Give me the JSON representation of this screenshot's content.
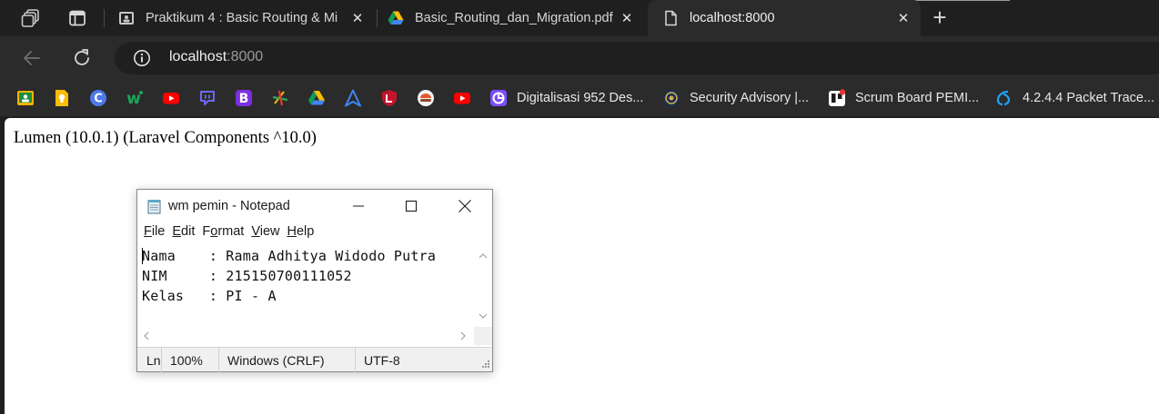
{
  "browser": {
    "tabs": [
      {
        "title": "Praktikum 4 : Basic Routing & Mi",
        "icon": "classroom-page-icon"
      },
      {
        "title": "Basic_Routing_dan_Migration.pdf",
        "icon": "google-drive-icon"
      },
      {
        "title": "localhost:8000",
        "icon": "page-icon",
        "active": true
      }
    ],
    "address": {
      "host": "localhost",
      "port": ":8000"
    },
    "bookmarks": [
      {
        "title": "Digitalisasi 952 Des..."
      },
      {
        "title": "Security Advisory |..."
      },
      {
        "title": "Scrum Board PEMI..."
      },
      {
        "title": "4.2.4.4 Packet Trace..."
      }
    ]
  },
  "page": {
    "text": "Lumen (10.0.1) (Laravel Components ^10.0)"
  },
  "notepad": {
    "title": "wm pemin - Notepad",
    "menu": [
      {
        "key": "F",
        "rest": "ile"
      },
      {
        "key": "E",
        "rest": "dit"
      },
      {
        "key": "o",
        "pre": "F",
        "rest": "rmat"
      },
      {
        "key": "V",
        "rest": "iew"
      },
      {
        "key": "H",
        "rest": "elp"
      }
    ],
    "lines": [
      "Nama    : Rama Adhitya Widodo Putra",
      "NIM     : 215150700111052",
      "Kelas   : PI - A"
    ],
    "status": {
      "position": "Ln",
      "zoom": "100%",
      "line_ending": "Windows (CRLF)",
      "encoding": "UTF-8"
    }
  }
}
